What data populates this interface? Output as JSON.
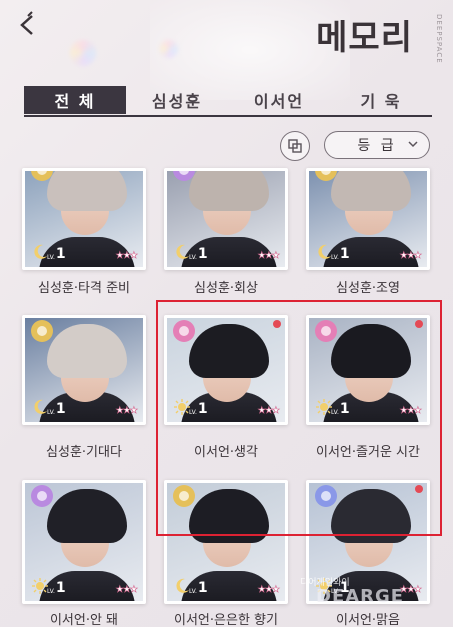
{
  "header": {
    "title": "메모리",
    "side_label": "DEEPSPACE"
  },
  "tabs": [
    {
      "label": "전 체",
      "active": true
    },
    {
      "label": "심성훈",
      "active": false
    },
    {
      "label": "이서언",
      "active": false
    },
    {
      "label": "기 욱",
      "active": false
    }
  ],
  "filters": {
    "grade_label": "등 급"
  },
  "lv_prefix": "LV.",
  "cards": [
    {
      "name": "심성훈·타격 준비",
      "level": "1",
      "stars": "★★★",
      "badge": "moon",
      "gem": "#e5c05a",
      "hair": "#c9c0bc",
      "bg": "#8ea3bd",
      "new": false
    },
    {
      "name": "심성훈·회상",
      "level": "1",
      "stars": "★★★",
      "badge": "moon",
      "gem": "#b98ae0",
      "hair": "#bdb3ad",
      "bg": "#9aa0b0",
      "new": false
    },
    {
      "name": "심성훈·조영",
      "level": "1",
      "stars": "★★★",
      "badge": "moon",
      "gem": "#e5c05a",
      "hair": "#c2b8b3",
      "bg": "#7e92b0",
      "new": false
    },
    {
      "name": "심성훈·기대다",
      "level": "1",
      "stars": "★★★",
      "badge": "moon",
      "gem": "#e5c05a",
      "hair": "#d3ccc8",
      "bg": "#6a7fa0",
      "new": false
    },
    {
      "name": "이서언·생각",
      "level": "1",
      "stars": "★★★",
      "badge": "sun",
      "gem": "#e47fb6",
      "hair": "#1c1c22",
      "bg": "#c9d3de",
      "new": true
    },
    {
      "name": "이서언·즐거운 시간",
      "level": "1",
      "stars": "★★★",
      "badge": "sun",
      "gem": "#e47fb6",
      "hair": "#1a1a20",
      "bg": "#a9b3c4",
      "new": true
    },
    {
      "name": "이서언·안 돼",
      "level": "1",
      "stars": "★★★",
      "badge": "sun",
      "gem": "#b98ae0",
      "hair": "#202027",
      "bg": "#bcc6d6",
      "new": false
    },
    {
      "name": "이서언·은은한 향기",
      "level": "1",
      "stars": "★★★",
      "badge": "moon",
      "gem": "#e5c05a",
      "hair": "#1d1d24",
      "bg": "#c2ccd8",
      "new": false
    },
    {
      "name": "이서언·맑음",
      "level": "1",
      "stars": "★★★",
      "badge": "sun",
      "gem": "#8a98e8",
      "hair": "#2a2a32",
      "bg": "#b6c2d4",
      "new": true
    }
  ],
  "watermark": {
    "line1": "디어게임와이",
    "line2": "DEARGE"
  },
  "colors": {
    "tab_active_bg": "#3b3640",
    "highlight": "#dd2233",
    "new_dot": "#e44a55"
  }
}
